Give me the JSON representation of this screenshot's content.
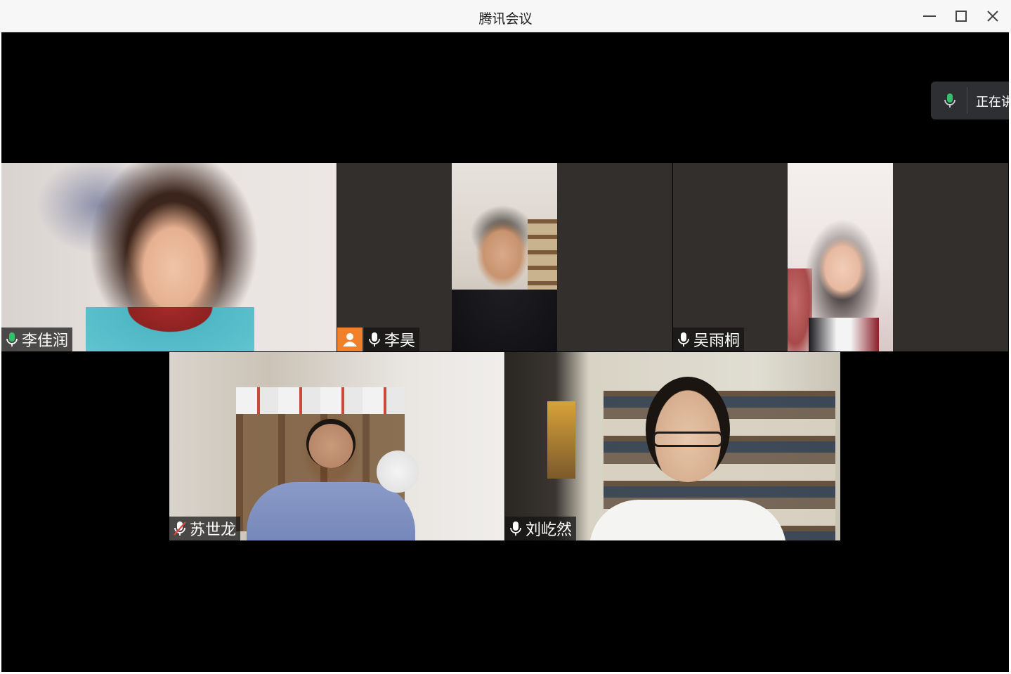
{
  "window": {
    "title": "腾讯会议"
  },
  "speaking_indicator": {
    "label": "正在讲"
  },
  "participants": [
    {
      "name": "李佳润",
      "mic": "on",
      "speaking": true
    },
    {
      "name": "李昊",
      "mic": "on",
      "host_badge": true
    },
    {
      "name": "吴雨桐",
      "mic": "on"
    },
    {
      "name": "苏世龙",
      "mic": "muted"
    },
    {
      "name": "刘屹然",
      "mic": "on"
    }
  ],
  "colors": {
    "active_border": "#2fc26b",
    "mic_active": "#2fc26b",
    "mic_muted": "#e0453a",
    "host_badge": "#f0802a",
    "stage_background": "#000000",
    "letterbox": "#322f2d"
  },
  "icons": {
    "minimize": "minimize-icon",
    "maximize": "maximize-icon",
    "close": "close-icon",
    "mic": "microphone-icon",
    "mic_muted": "microphone-muted-icon",
    "host": "person-icon"
  }
}
